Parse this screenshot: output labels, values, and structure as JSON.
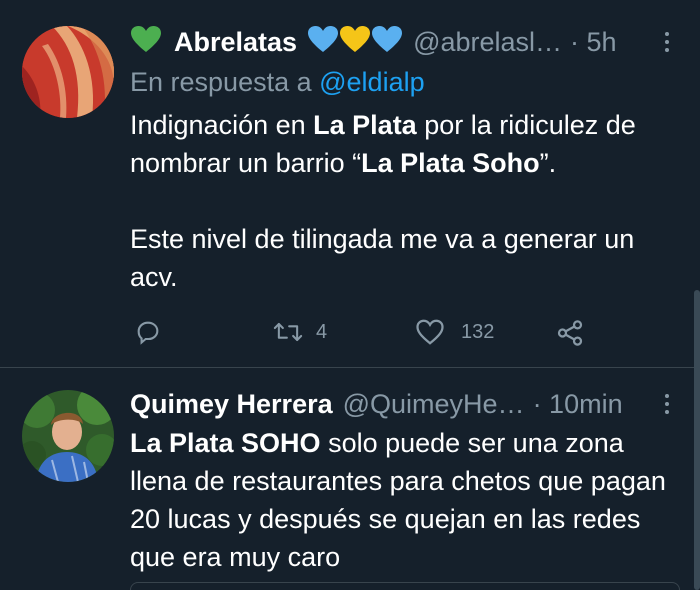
{
  "tweets": [
    {
      "name": "Abrelatas",
      "handle": "@abrelasl…",
      "time": "· 5h",
      "reply_prefix": "En respuesta a ",
      "reply_to": "@eldialp",
      "text": {
        "p1_a": "Indignación en ",
        "p1_b": "La Plata",
        "p1_c": " por la ridiculez de nombrar un barrio “",
        "p1_d": "La Plata Soho",
        "p1_e": "”.",
        "p2": "Este nivel de tilingada me va a generar un acv."
      },
      "retweets": "4",
      "likes": "132",
      "colors": {
        "green_heart": "#4caf50",
        "blue_heart": "#5ab0f0",
        "yellow_heart": "#f5c518"
      }
    },
    {
      "name": "Quimey Herrera",
      "handle": "@QuimeyHe…",
      "time": "· 10min",
      "text": {
        "a": "La Plata SOHO",
        "b": " solo puede ser una zona llena de restaurantes para chetos que pagan 20 lucas y después se quejan en las redes que era muy caro"
      }
    }
  ],
  "icons": [
    "heart-green-icon",
    "heart-blue-icon",
    "heart-yellow-icon",
    "more-icon",
    "reply-icon",
    "retweet-icon",
    "like-icon",
    "share-icon"
  ]
}
